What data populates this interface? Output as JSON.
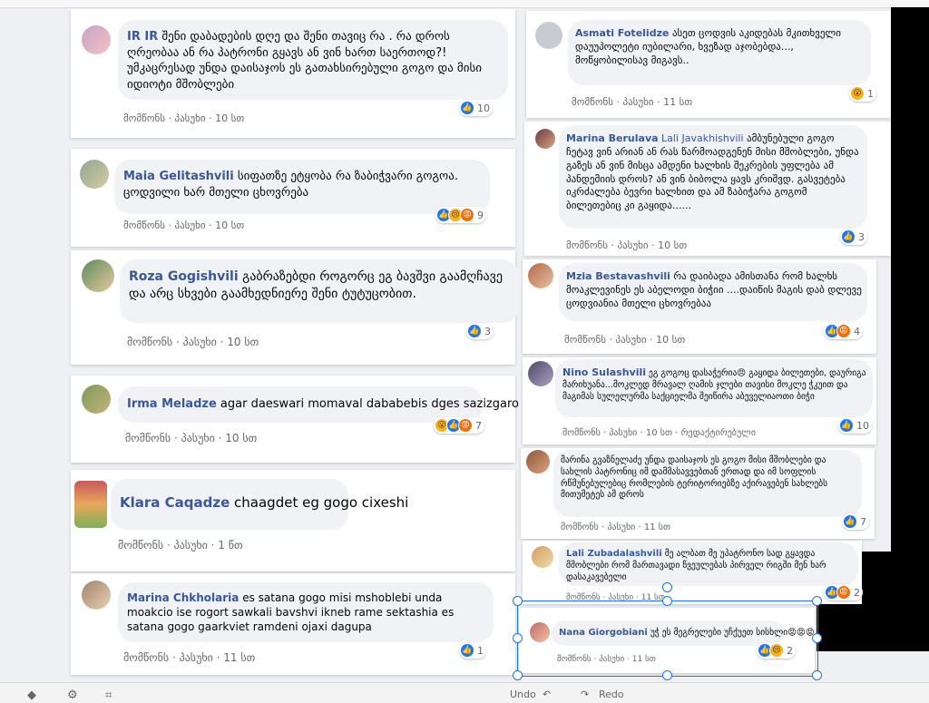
{
  "comments_left": [
    {
      "name": "IR IR",
      "text": "შენი დაბადების დღე და შენი თავიც რა . რა დროს ღრეობაა ან რა პატრონი გყავს ან ვინ ხართ საერთოდ?! უმკაცრესად უნდა დაისაჯოს ეს გათახსირებული გოგო და მისი იდიოტი მშობლები",
      "like": "მომწონს",
      "reply": "პასუხი",
      "time": "10 სთ",
      "count": "10",
      "reactions": [
        "like"
      ]
    },
    {
      "name": "Maia Gelitashvili",
      "text": "სიფათზე ეტყობა რა ზაბიჭვარი გოგოა. ცოდვილი ხარ მთელი ცხოვრება",
      "like": "მომწონს",
      "reply": "პასუხი",
      "time": "10 სთ",
      "count": "9",
      "reactions": [
        "like",
        "sad",
        "angry"
      ]
    },
    {
      "name": "Roza Gogishvili",
      "text": "გაბრაზებდი როგორც ეგ ბავშვი გაამღჩავე და არც სხვები გაამხედნიერე შენი ტუტუცობით.",
      "like": "მომწონს",
      "reply": "პასუხი",
      "time": "10 სთ",
      "count": "3",
      "reactions": [
        "like"
      ]
    },
    {
      "name": "Irma Meladze",
      "text": "agar daeswari momaval dababebis dges sazizgaro",
      "like": "მომწონს",
      "reply": "პასუხი",
      "time": "10 სთ",
      "count": "7",
      "reactions": [
        "wow",
        "like",
        "angry"
      ]
    },
    {
      "name": "Klara Caqadze",
      "text": "chaagdet eg gogo cixeshi",
      "like": "მომწონს",
      "reply": "პასუხი",
      "time": "1 წთ",
      "count": "",
      "reactions": []
    },
    {
      "name": "Marina Chkholaria",
      "text": "es satana gogo misi mshoblebi unda moakcio ise rogort sawkali bavshvi ikneb rame sektashia es satana gogo gaarkviet ramdeni ojaxi dagupa",
      "like": "მომწონს",
      "reply": "პასუხი",
      "time": "11 სთ",
      "count": "1",
      "reactions": [
        "like"
      ]
    }
  ],
  "comments_right": [
    {
      "name": "Asmati Fotelidze",
      "text": "ასეთ ცოდვის აკიდებას მკითხველი დაუუპოლეტი იუბილარი, ხვეზად აჯობებდა..., მოწყობილისავ მიგავს..",
      "like": "მომწონს",
      "reply": "პასუხი",
      "time": "11 სთ",
      "count": "1",
      "reactions": [
        "wow"
      ]
    },
    {
      "name": "Marina Berulava",
      "tag": "Lali Javakhishvili",
      "text": "ამბუნებული გოგო ჩეტავ ვინ არიან ან რას წარმოადგენენ მისი მშობლები, უნდა გაზეს ან ვინ მისცა ამდენი ხალხის შეკრების უფლება ამ პანდემიის დროს? ან ვინ ბიბოლა ყავს კრიშვდ. გასვეტება იკრძალება ბევრი ხალხით და ამ ზაბიჭარა გოგომ ბილეთებიც კი გაყიდა......",
      "like": "მომწონს",
      "reply": "პასუხი",
      "time": "10 სთ",
      "count": "3",
      "reactions": [
        "like"
      ]
    },
    {
      "name": "Mzia Bestavashvili",
      "text": "რა დაიბადა ამისთანა რომ ხალხს მოაკლევინეს ეს აბელოდი ბიჭიი ....დაიწის მაგის დაბ დლევე ცოდვიანია მთელი ცხოვრებაა",
      "like": "მომწონს",
      "reply": "პასუხი",
      "time": "10 სთ",
      "count": "4",
      "reactions": [
        "like",
        "angry"
      ]
    },
    {
      "name": "Nino Sulashvili",
      "text": "ეგ გოგოც დასაჭერია😠 გაყიდა ბილეთები, დაურიგა მარიხუანა...მოკლედ მრავალ ღამის ჯლები თავისი მოკლე ჭკუით და მაგიმას სულელურმა საქციელმა შეიწირა აბეველიაოთი ბიჭი",
      "like": "მომწონს",
      "reply": "პასუხი",
      "time": "10 სთ",
      "extra": "რედაქტირებული",
      "count": "10",
      "reactions": [
        "like"
      ]
    },
    {
      "name": "",
      "text": "მარინა გვაზნელაძე უნდა დაისაჯოს ეს გოგო მისი მშობლები და სახლის პატრონიც იმ დამმასავვებთან ერთად და იმ სოფლის რწმუნებულებიც რომლების ტერიტორიებზე აქირავებენ სახლებს მითუმეტეს ამ დროს",
      "like": "მომწონს",
      "reply": "პასუხი",
      "time": "11 სთ",
      "count": "7",
      "reactions": [
        "like"
      ]
    },
    {
      "name": "Lali Zubadalashvili",
      "text": "მე ალბათ მე უპატრონო სად გყავდა მშობლები რომ მართავადი წვეულებას პირველ რიგში მენ ხარ დასაკავებელი",
      "like": "მომწონს",
      "reply": "პასუხი",
      "time": "11 სთ",
      "count": "2",
      "reactions": [
        "like",
        "angry"
      ]
    },
    {
      "name": "Nana Giorgobiani",
      "text": "უჭ ეს მეგრელები უჩქუეთ სისხლი😡😡😡",
      "like": "მომწონს",
      "reply": "პასუხი",
      "time": "11 სთ",
      "count": "2",
      "reactions": [
        "like",
        "sad"
      ]
    }
  ],
  "toolbar": {
    "undo": "Undo",
    "redo": "Redo"
  },
  "colors": {
    "link": "#385898",
    "like": "#1877f2",
    "bubble": "#f0f2f5",
    "selection": "#1a73e8"
  }
}
